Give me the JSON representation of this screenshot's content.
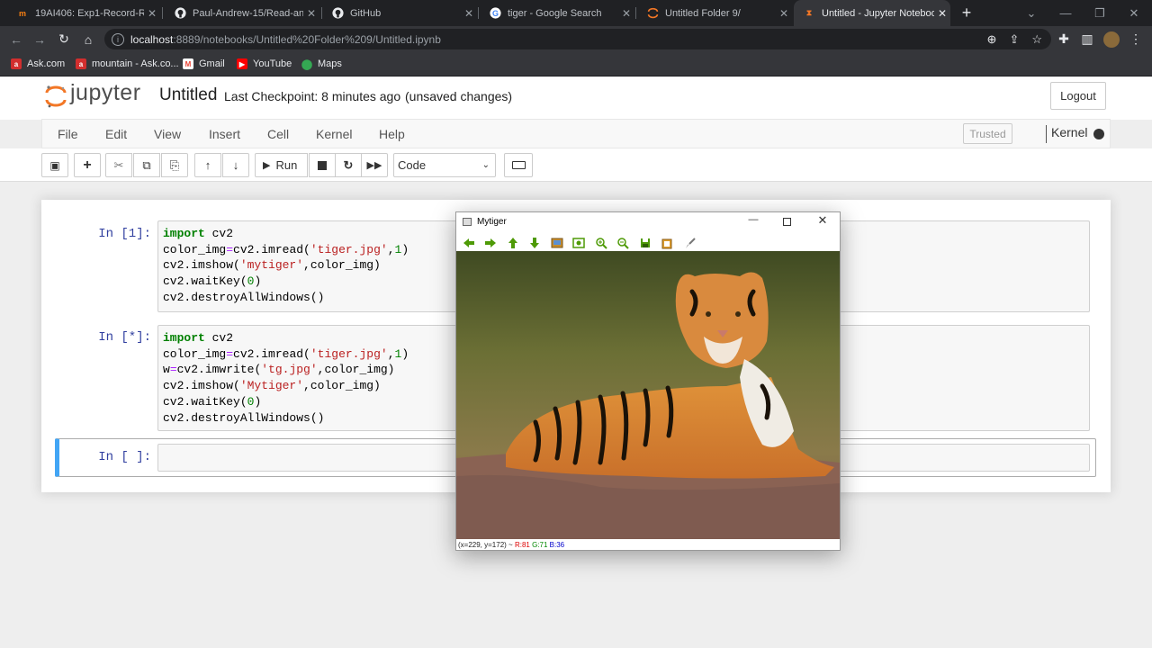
{
  "browser": {
    "tabs": [
      {
        "title": "19AI406: Exp1-Record-Rea",
        "icon": "moodle-icon"
      },
      {
        "title": "Paul-Andrew-15/Read-and",
        "icon": "github-icon"
      },
      {
        "title": "GitHub",
        "icon": "github-icon"
      },
      {
        "title": "tiger - Google Search",
        "icon": "google-icon"
      },
      {
        "title": "Untitled Folder 9/",
        "icon": "jupyter-icon"
      },
      {
        "title": "Untitled - Jupyter Noteboo",
        "icon": "hourglass-icon"
      }
    ],
    "new_tab": "+",
    "url_host": "localhost",
    "url_path": ":8889/notebooks/Untitled%20Folder%209/Untitled.ipynb",
    "bookmarks": [
      {
        "label": "Ask.com",
        "color": "#d22e2e"
      },
      {
        "label": "mountain - Ask.co...",
        "color": "#d22e2e"
      },
      {
        "label": "Gmail",
        "color": "#ea4335"
      },
      {
        "label": "YouTube",
        "color": "#ff0000"
      },
      {
        "label": "Maps",
        "color": "#34a853"
      }
    ]
  },
  "jupyter": {
    "logo_text": "jupyter",
    "notebook_name": "Untitled",
    "checkpoint": "Last Checkpoint: 8 minutes ago",
    "unsaved": "(unsaved changes)",
    "logout": "Logout",
    "menu": [
      "File",
      "Edit",
      "View",
      "Insert",
      "Cell",
      "Kernel",
      "Help"
    ],
    "trusted": "Trusted",
    "kernel": "Kernel",
    "run_label": "Run",
    "cell_type": "Code",
    "accent": "#f37726"
  },
  "cells": [
    {
      "prompt": "In [1]:"
    },
    {
      "prompt": "In [*]:"
    },
    {
      "prompt": "In [ ]:"
    }
  ],
  "cv_window": {
    "title": "Mytiger",
    "status_coords": "(x=229, y=172) ~",
    "status_r": "R:81",
    "status_g": "G:71",
    "status_b": "B:36"
  }
}
